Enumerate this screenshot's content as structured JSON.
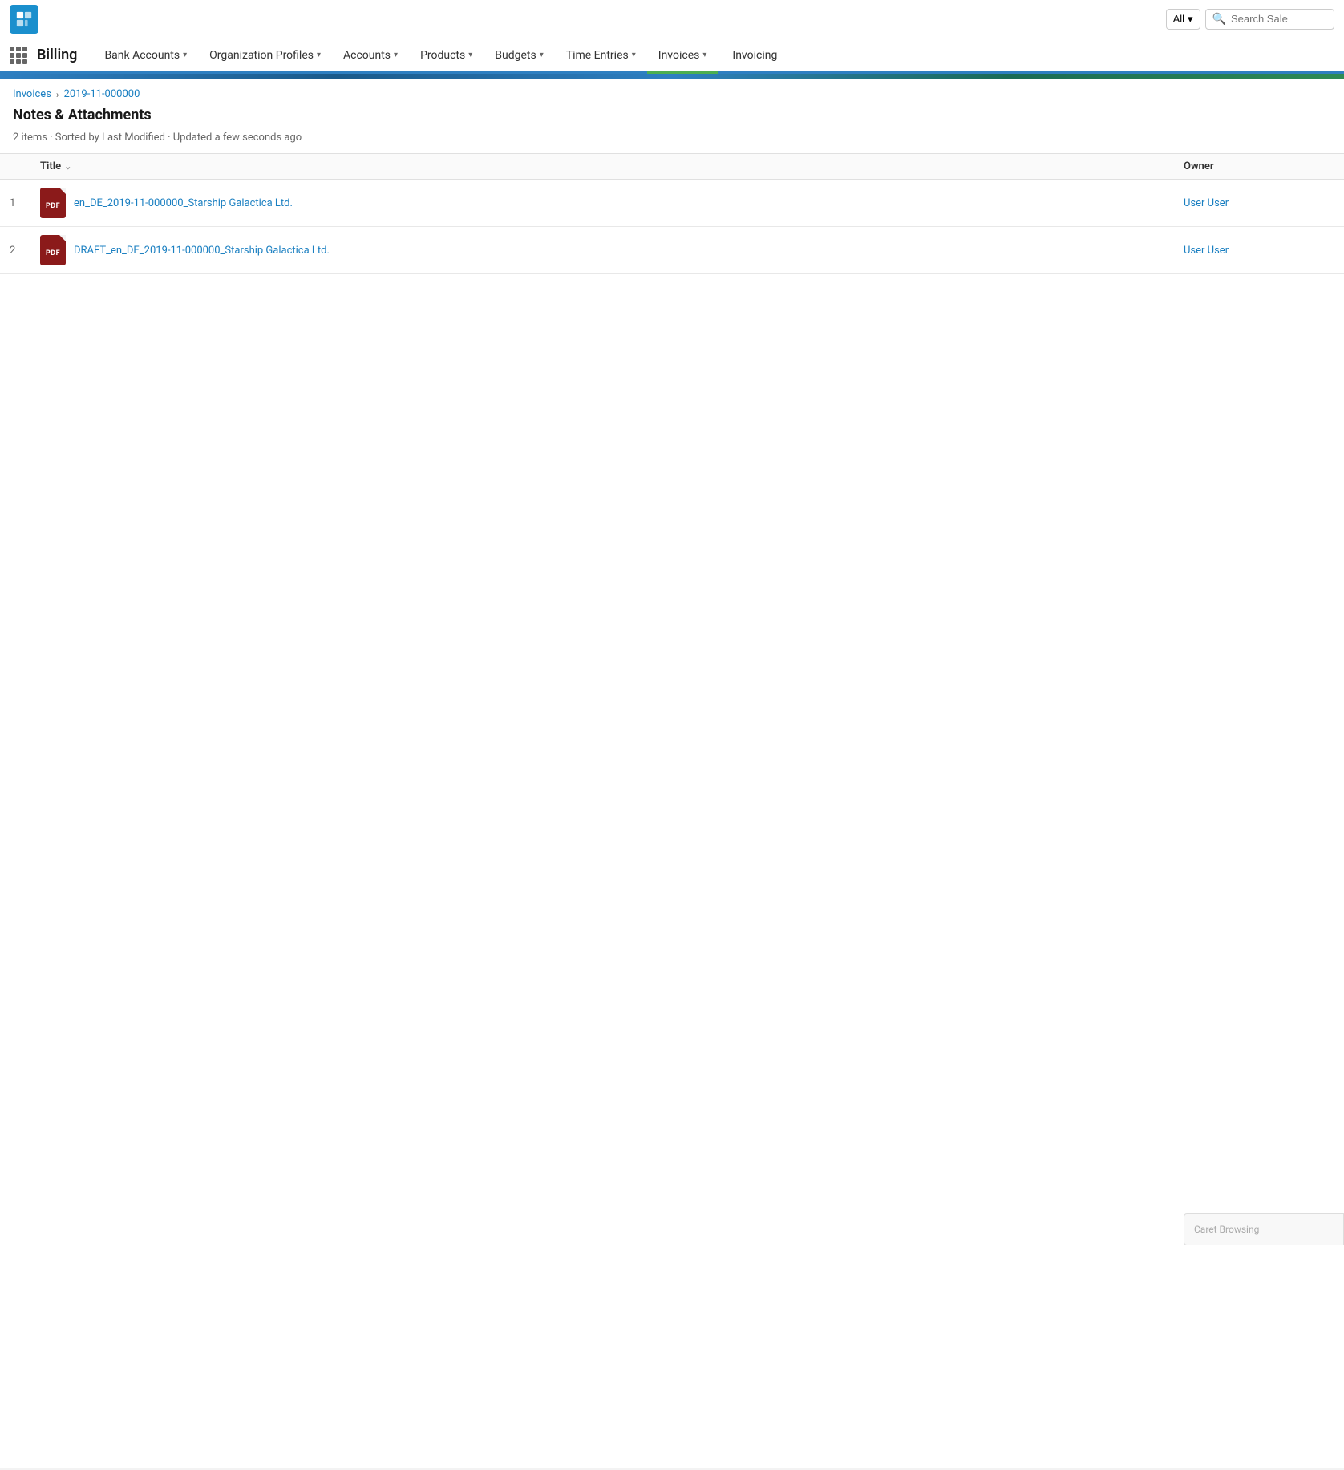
{
  "topbar": {
    "search_placeholder": "Search Sale",
    "all_label": "All"
  },
  "navbar": {
    "title": "Billing",
    "items": [
      {
        "label": "Bank Accounts",
        "has_dropdown": true,
        "active": false
      },
      {
        "label": "Organization Profiles",
        "has_dropdown": true,
        "active": false
      },
      {
        "label": "Accounts",
        "has_dropdown": true,
        "active": false
      },
      {
        "label": "Products",
        "has_dropdown": true,
        "active": false
      },
      {
        "label": "Budgets",
        "has_dropdown": true,
        "active": false
      },
      {
        "label": "Time Entries",
        "has_dropdown": true,
        "active": false
      },
      {
        "label": "Invoices",
        "has_dropdown": true,
        "active": true
      },
      {
        "label": "Invoicing",
        "has_dropdown": false,
        "active": false
      }
    ]
  },
  "breadcrumb": {
    "parent": "Invoices",
    "current": "2019-11-000000"
  },
  "page": {
    "title": "Notes & Attachments",
    "subtitle": "2 items · Sorted by Last Modified · Updated a few seconds ago"
  },
  "table": {
    "columns": {
      "title": "Title",
      "owner": "Owner"
    },
    "rows": [
      {
        "num": "1",
        "filename": "en_DE_2019-11-000000_Starship Galactica Ltd.",
        "owner": "User User"
      },
      {
        "num": "2",
        "filename": "DRAFT_en_DE_2019-11-000000_Starship Galactica Ltd.",
        "owner": "User User"
      }
    ]
  },
  "caret": {
    "label": "Caret Browsing"
  }
}
